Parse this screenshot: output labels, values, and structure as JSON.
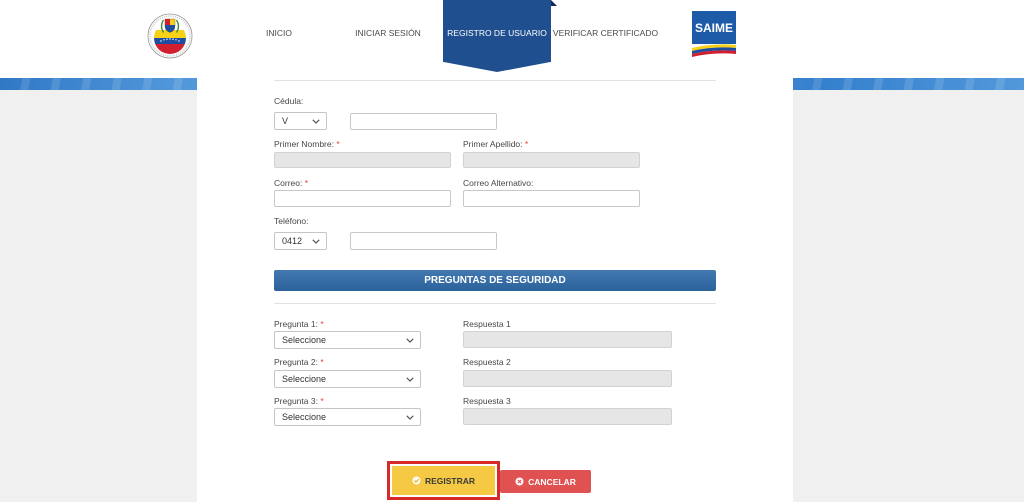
{
  "header": {
    "nav": [
      {
        "label": "INICIO",
        "active": false
      },
      {
        "label": "INICIAR SESIÓN",
        "active": false
      },
      {
        "label": "REGISTRO DE USUARIO",
        "active": true
      },
      {
        "label": "VERIFICAR CERTIFICADO",
        "active": false
      }
    ],
    "left_logo_icon": "venezuela-coat-of-arms-icon",
    "right_logo_text": "SAIME"
  },
  "form": {
    "cedula": {
      "label": "Cédula:",
      "type": "V",
      "number": ""
    },
    "first_name": {
      "label": "Primer Nombre:",
      "required_mark": "*",
      "value": ""
    },
    "last_name": {
      "label": "Primer Apellido:",
      "required_mark": "*",
      "value": ""
    },
    "email": {
      "label": "Correo:",
      "required_mark": "*",
      "value": ""
    },
    "alt_email": {
      "label": "Correo Alternativo:",
      "value": ""
    },
    "phone": {
      "label": "Teléfono:",
      "prefix": "0412",
      "number": ""
    }
  },
  "security": {
    "title": "PREGUNTAS DE SEGURIDAD",
    "questions": [
      {
        "label": "Pregunta 1:",
        "required_mark": "*",
        "selected": "Seleccione",
        "answer_label": "Respuesta 1",
        "answer_value": ""
      },
      {
        "label": "Pregunta 2:",
        "required_mark": "*",
        "selected": "Seleccione",
        "answer_label": "Respuesta 2",
        "answer_value": ""
      },
      {
        "label": "Pregunta 3:",
        "required_mark": "*",
        "selected": "Seleccione",
        "answer_label": "Respuesta 3",
        "answer_value": ""
      }
    ]
  },
  "actions": {
    "register_label": "REGISTRAR",
    "register_icon": "check-circle-icon",
    "cancel_label": "CANCELAR",
    "cancel_icon": "cancel-circle-icon"
  },
  "icons": {
    "select_arrow": "chevron-down-icon"
  },
  "colors": {
    "primary_blue": "#1f4f8f",
    "band_blue": "#3a8ad6",
    "section_blue": "#2e6aa8",
    "register_yellow": "#f6c945",
    "cancel_red": "#e05252",
    "highlight_red": "#d62a2a",
    "required_red": "#e03c3c",
    "disabled_gray": "#e6e6e6",
    "page_bg": "#f0f0f0"
  }
}
